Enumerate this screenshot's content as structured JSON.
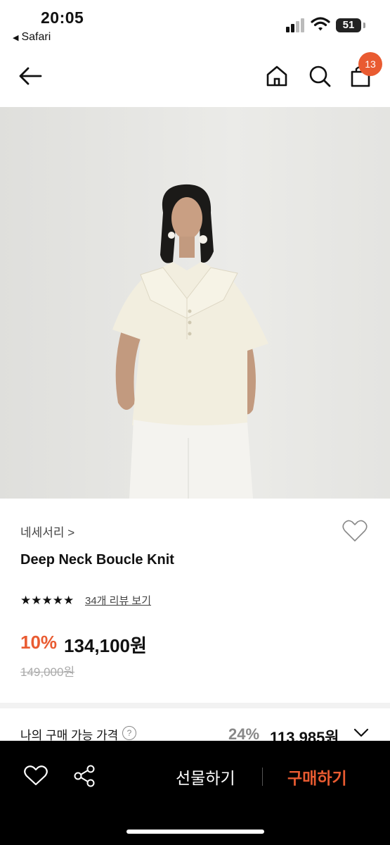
{
  "status_bar": {
    "time": "20:05",
    "back_app": "Safari",
    "battery": "51"
  },
  "header": {
    "back_icon": "arrow-left-icon",
    "home_icon": "home-icon",
    "search_icon": "search-icon",
    "cart_icon": "shopping-bag-icon",
    "cart_count": "13"
  },
  "product": {
    "image": "product-photo",
    "brand": "네세서리 >",
    "name": "Deep Neck Boucle Knit",
    "stars": "★★★★★",
    "rating": 5,
    "review_link": "34개 리뷰 보기",
    "discount": "10%",
    "price": "134,100원",
    "original_price": "149,000원"
  },
  "my_price": {
    "label": "나의 구매 가능 가격",
    "help": "?",
    "discount": "24%",
    "price": "113,985원"
  },
  "bottom_bar": {
    "gift_label": "선물하기",
    "buy_label": "구매하기"
  },
  "colors": {
    "accent": "#e95b31",
    "bottom_bar": "#000000",
    "image_background": "#e7e7e4"
  }
}
